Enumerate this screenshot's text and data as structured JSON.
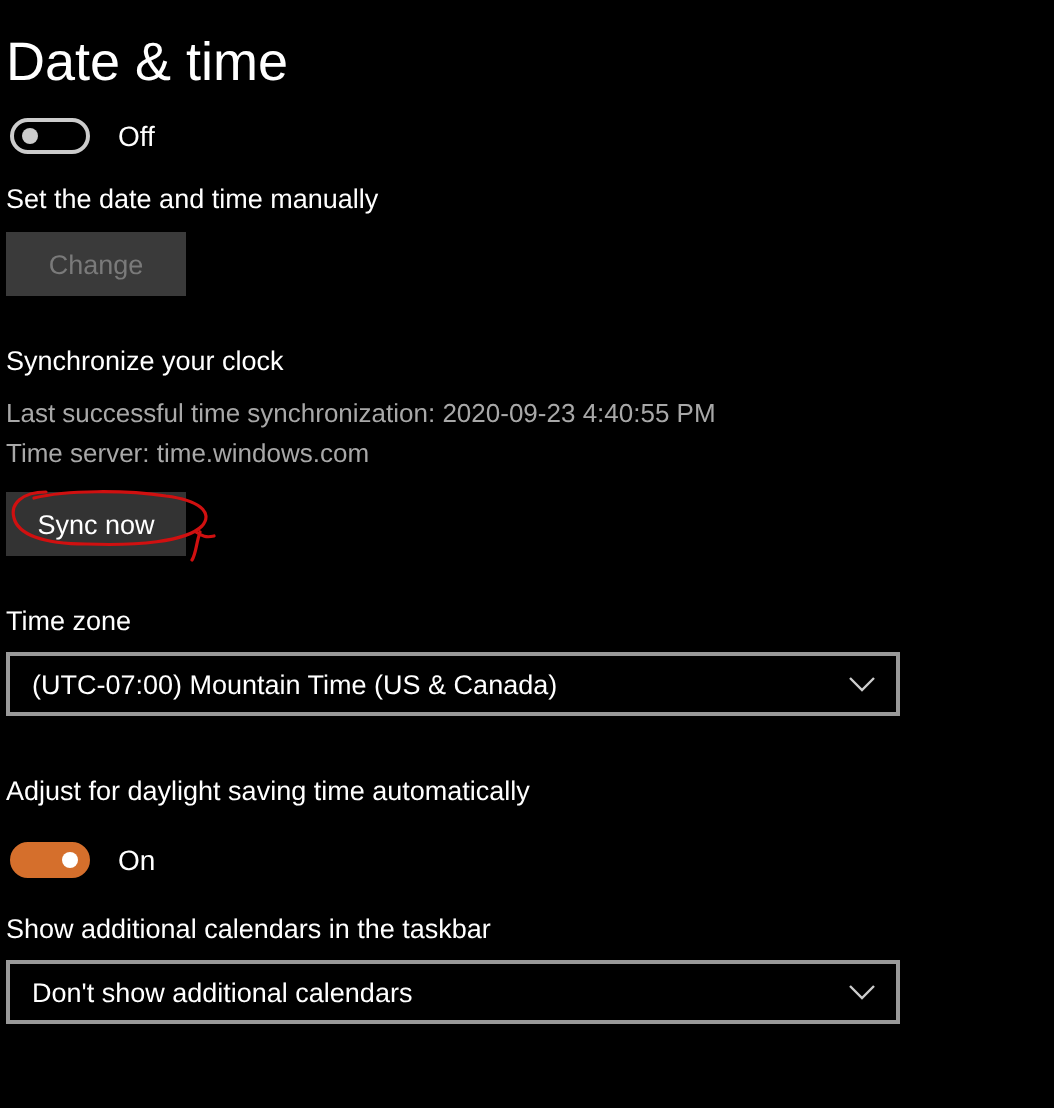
{
  "title": "Date & time",
  "set_time_automatically": {
    "on": false,
    "state_label": "Off"
  },
  "manual": {
    "label": "Set the date and time manually",
    "button": {
      "label": "Change",
      "disabled": true
    }
  },
  "sync": {
    "heading": "Synchronize your clock",
    "lines": [
      "Last successful time synchronization: 2020-09-23 4:40:55 PM",
      "Time server: time.windows.com"
    ],
    "button": {
      "label": "Sync now",
      "disabled": false
    },
    "annotated": true
  },
  "time_zone": {
    "label": "Time zone",
    "value": "(UTC-07:00) Mountain Time (US & Canada)"
  },
  "daylight_saving": {
    "label": "Adjust for daylight saving time automatically",
    "on": true,
    "state_label": "On"
  },
  "additional_calendars": {
    "label": "Show additional calendars in the taskbar",
    "value": "Don't show additional calendars"
  }
}
